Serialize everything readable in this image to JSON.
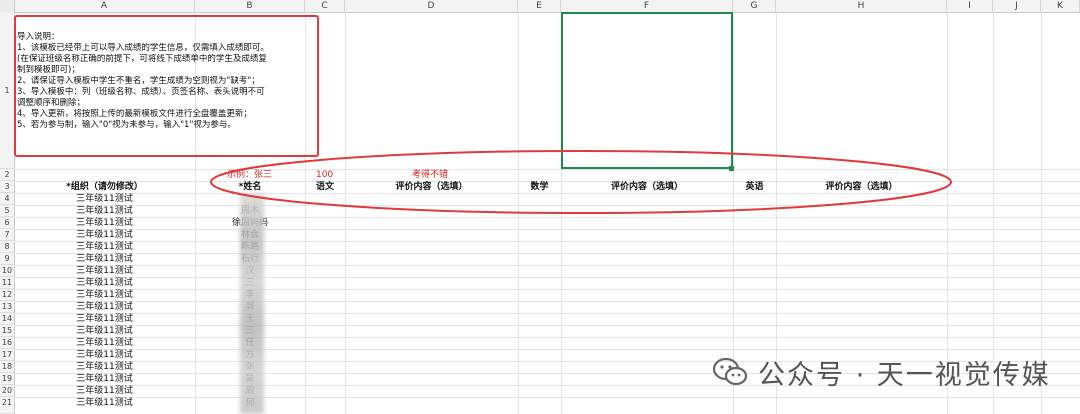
{
  "columns": [
    "A",
    "B",
    "C",
    "D",
    "E",
    "F",
    "G",
    "H",
    "I",
    "J",
    "K"
  ],
  "rows": [
    "1",
    "2",
    "3",
    "4",
    "5",
    "6",
    "7",
    "8",
    "9",
    "10",
    "11",
    "12",
    "13",
    "14",
    "15",
    "16",
    "17",
    "18",
    "19",
    "20",
    "21"
  ],
  "instructions": {
    "title": "导入说明：",
    "lines": [
      "1、该模板已经带上可以导入成绩的学生信息，仅需填入成绩即可。",
      "(在保证班级名称正确的前提下，可将线下成绩单中的学生及成绩复",
      "制到模板即可)；",
      "2、请保证导入模板中学生不重名，学生成绩为空则视为\"缺考\"；",
      "3、导入模板中：列（班级名称、成绩）、页签名称、表头说明不可",
      "调整顺序和删除；",
      "4、导入更新，将按照上传的最新模板文件进行全盘覆盖更新；",
      "5、若为参与制，输入\"0\"视为未参与，输入\"1\"视为参与。"
    ]
  },
  "example_row": {
    "name": "示例：张三",
    "score": "100",
    "comment": "考得不错"
  },
  "headers": {
    "class": "*组织（请勿修改）",
    "name": "*姓名",
    "chinese": "语文",
    "chinese_comment": "评价内容（选填）",
    "math": "数学",
    "math_comment": "评价内容（选填）",
    "english": "英语",
    "english_comment": "评价内容（选填）"
  },
  "class_name": "三年级11测试",
  "names": [
    "",
    "周木",
    "徐周妈妈",
    "林合",
    "陈路",
    "石行",
    "汉",
    "三",
    "李",
    "郭",
    "王",
    "三",
    "任",
    "方",
    "张",
    "吴",
    "周",
    "何"
  ],
  "watermark": {
    "text": "公众号 · 天一视觉传媒"
  },
  "colors": {
    "annotation_red": "#e23a3a",
    "selection_green": "#1e8a4d"
  }
}
